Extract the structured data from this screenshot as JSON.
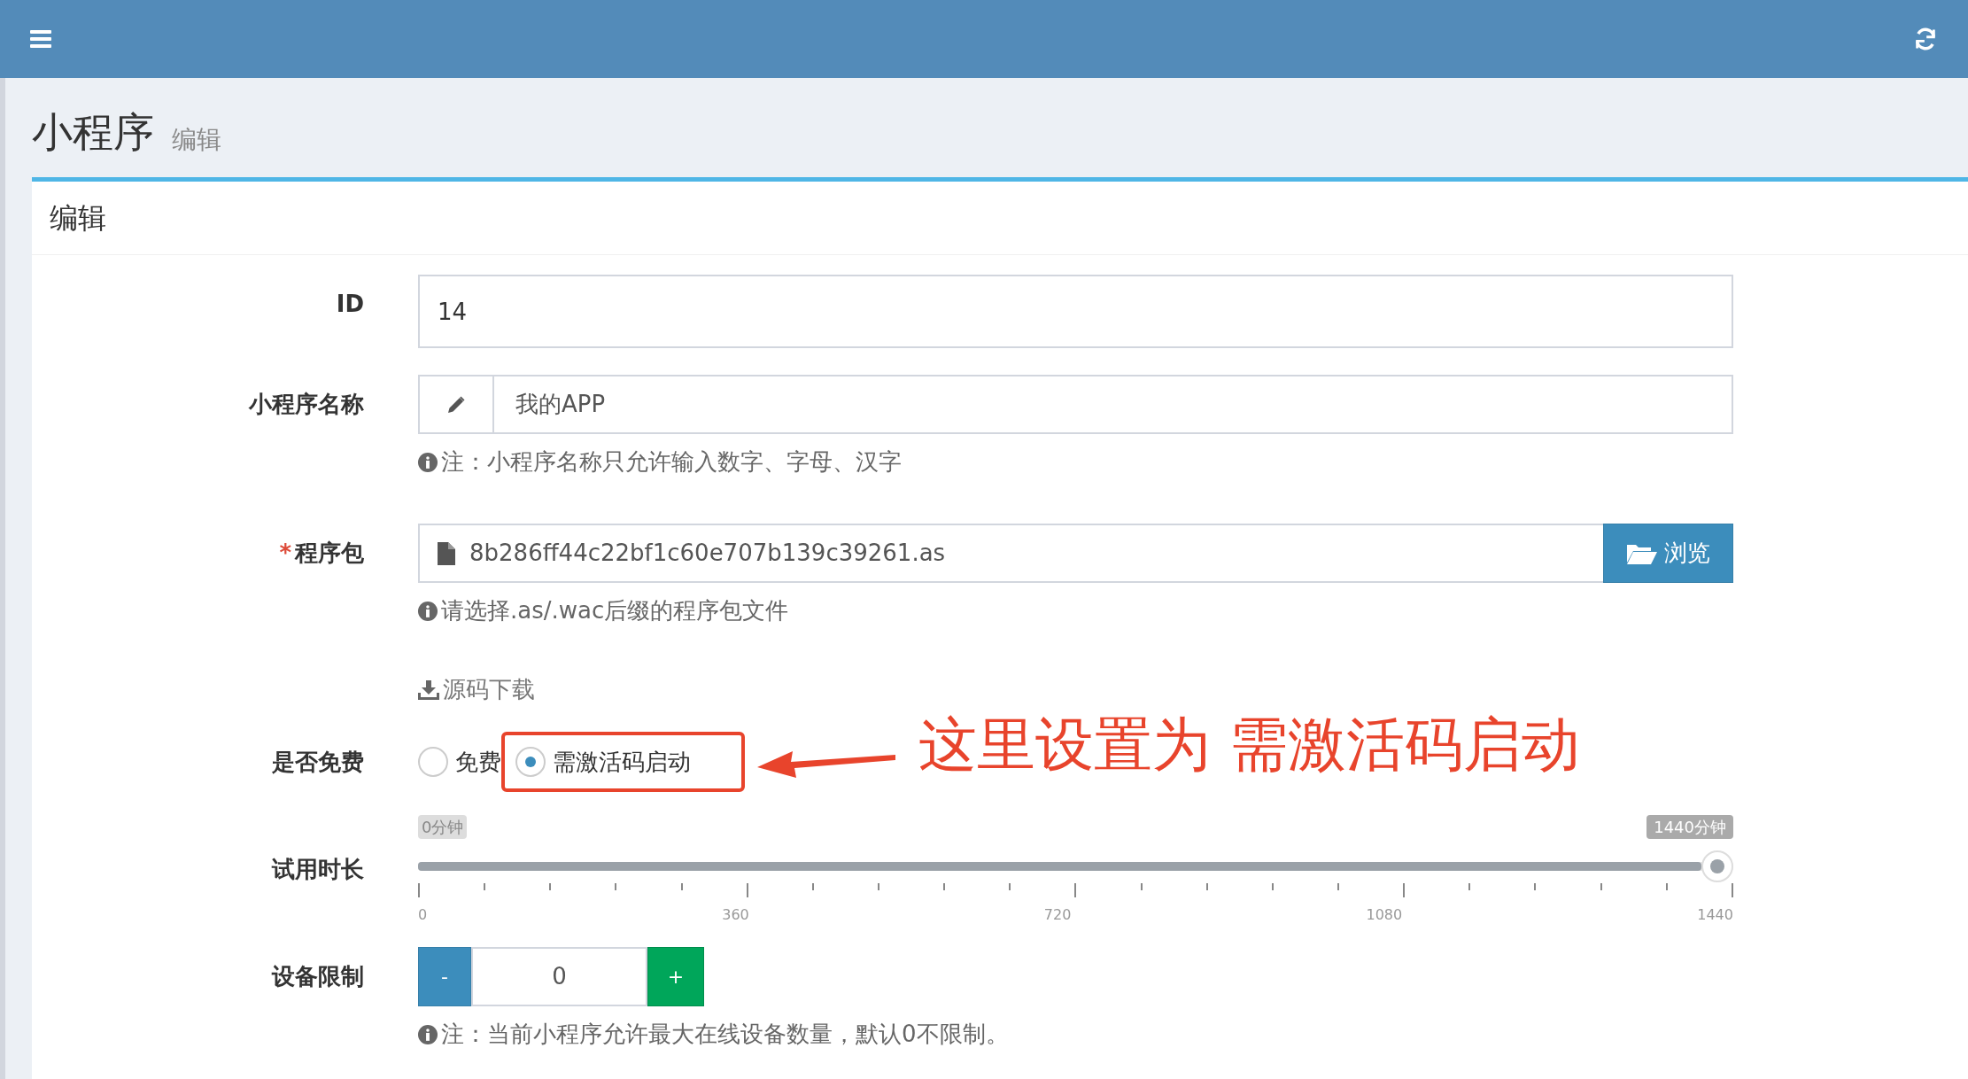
{
  "page": {
    "title": "小程序",
    "subtitle": "编辑"
  },
  "card": {
    "title": "编辑"
  },
  "fields": [
    {
      "kind": "text",
      "label": "ID",
      "value": "14"
    },
    {
      "kind": "icon-text",
      "label": "小程序名称",
      "value": "我的APP",
      "help": "注：小程序名称只允许输入数字、字母、汉字"
    },
    {
      "kind": "file",
      "label": "程序包",
      "required_mark": "*",
      "value": "8b286ff44c22bf1c60e707b139c39261.as",
      "button": "浏览",
      "help": "请选择.as/.wac后缀的程序包文件"
    },
    {
      "kind": "link",
      "link": "源码下载"
    },
    {
      "kind": "radio",
      "label": "是否免费",
      "options": [
        {
          "label": "免费",
          "selected": false,
          "highlighted": false
        },
        {
          "label": "需激活码启动",
          "selected": true,
          "highlighted": true
        }
      ]
    },
    {
      "kind": "slider",
      "label": "试用时长",
      "min_label": "0分钟",
      "max_label": "1440分钟",
      "level": 1,
      "tick_labels": [
        "0",
        "360",
        "720",
        "1080",
        "1440"
      ]
    },
    {
      "kind": "stepper",
      "label": "设备限制",
      "minus": "-",
      "value": "0",
      "plus": "+",
      "help": "注：当前小程序允许最大在线设备数量，默认0不限制。"
    }
  ],
  "annotation": {
    "text": "这里设置为 需激活码启动"
  }
}
